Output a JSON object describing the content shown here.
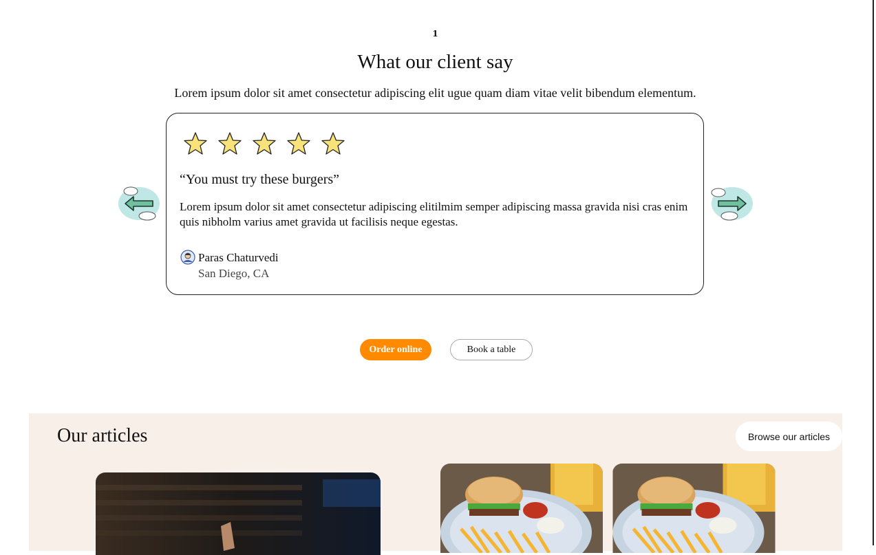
{
  "testimonials": {
    "slide_index": "1",
    "title": "What our client say",
    "subtitle": "Lorem ipsum dolor sit amet consectetur adipiscing elit ugue quam diam vitae velit bibendum elementum.",
    "rating": 5,
    "quote_title": "“You must try these burgers”",
    "quote_body": "Lorem ipsum dolor sit amet consectetur adipiscing elitilmim semper adipiscing massa gravida nisi cras enim quis nibholm varius amet gravida ut facilisis neque egestas.",
    "author_name": "Paras Chaturvedi",
    "author_location": "San Diego, CA",
    "prev_icon": "left-arrow-cloud-icon",
    "next_icon": "right-arrow-cloud-icon"
  },
  "actions": {
    "order_label": "Order online",
    "book_label": "Book a table"
  },
  "articles": {
    "title": "Our articles",
    "browse_label": "Browse our articles"
  },
  "colors": {
    "accent": "#ff8a00",
    "articles_bg": "#f8f0e8",
    "star_fill": "#f8e27a"
  }
}
